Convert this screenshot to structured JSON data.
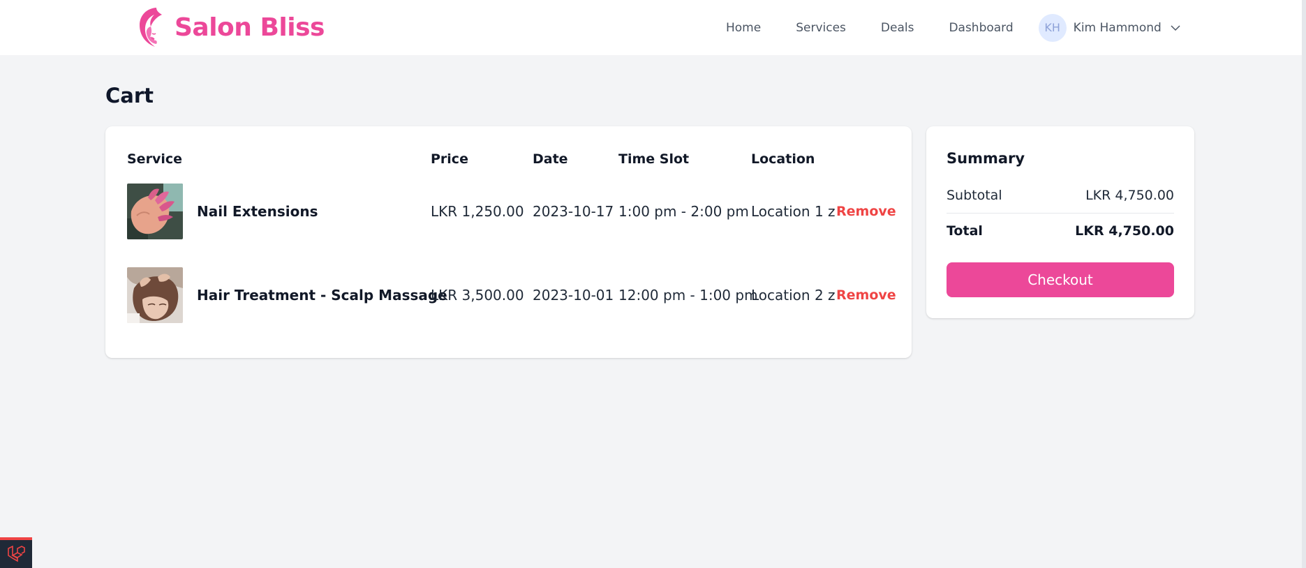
{
  "brand": {
    "name": "Salon Bliss",
    "color": "#ec4899"
  },
  "nav": {
    "items": [
      {
        "label": "Home"
      },
      {
        "label": "Services"
      },
      {
        "label": "Deals"
      },
      {
        "label": "Dashboard"
      }
    ],
    "user": {
      "initials": "KH",
      "name": "Kim Hammond"
    }
  },
  "page": {
    "title": "Cart"
  },
  "cart": {
    "headers": {
      "service": "Service",
      "price": "Price",
      "date": "Date",
      "time_slot": "Time Slot",
      "location": "Location"
    },
    "rows": [
      {
        "service": "Nail Extensions",
        "price": "LKR 1,250.00",
        "date": "2023-10-17",
        "time_slot": "1:00 pm - 2:00 pm",
        "location": "Location 1 z",
        "remove_label": "Remove",
        "image": "nail-extensions-photo"
      },
      {
        "service": "Hair Treatment - Scalp Massage",
        "price": "LKR 3,500.00",
        "date": "2023-10-01",
        "time_slot": "12:00 pm - 1:00 pm",
        "location": "Location 2 z",
        "remove_label": "Remove",
        "image": "scalp-massage-photo"
      }
    ]
  },
  "summary": {
    "title": "Summary",
    "subtotal_label": "Subtotal",
    "subtotal_value": "LKR 4,750.00",
    "total_label": "Total",
    "total_value": "LKR 4,750.00",
    "checkout_label": "Checkout"
  },
  "colors": {
    "accent": "#ec4899",
    "danger": "#ef4444",
    "background": "#f3f4f6"
  },
  "icons": [
    "salon-logo-icon",
    "chevron-down-icon",
    "laravel-icon"
  ]
}
